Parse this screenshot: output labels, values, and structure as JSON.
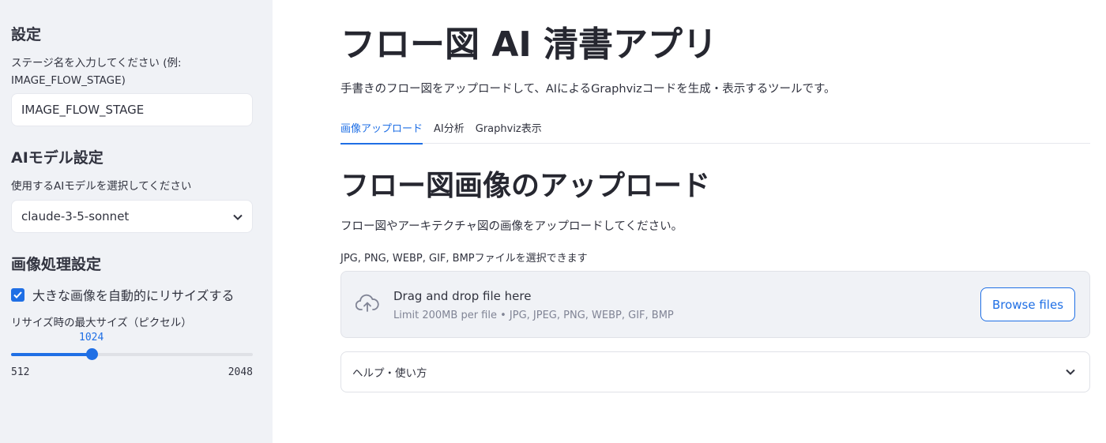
{
  "sidebar": {
    "settings_heading": "設定",
    "stage_label": "ステージ名を入力してください (例: IMAGE_FLOW_STAGE)",
    "stage_value": "IMAGE_FLOW_STAGE",
    "model_heading": "AIモデル設定",
    "model_label": "使用するAIモデルを選択してください",
    "model_selected": "claude-3-5-sonnet",
    "image_heading": "画像処理設定",
    "resize_checkbox_label": "大きな画像を自動的にリサイズする",
    "resize_checked": true,
    "max_size_label": "リサイズ時の最大サイズ（ピクセル）",
    "slider": {
      "value": "1024",
      "min": "512",
      "max": "2048"
    }
  },
  "main": {
    "title": "フロー図 AI 清書アプリ",
    "subtitle": "手書きのフロー図をアップロードして、AIによるGraphvizコードを生成・表示するツールです。",
    "tabs": [
      {
        "label": "画像アップロード",
        "active": true
      },
      {
        "label": "AI分析",
        "active": false
      },
      {
        "label": "Graphviz表示",
        "active": false
      }
    ],
    "section_title": "フロー図画像のアップロード",
    "section_desc": "フロー図やアーキテクチャ図の画像をアップロードしてください。",
    "uploader_label": "JPG, PNG, WEBP, GIF, BMPファイルを選択できます",
    "dropzone_title": "Drag and drop file here",
    "dropzone_sub": "Limit 200MB per file • JPG, JPEG, PNG, WEBP, GIF, BMP",
    "browse_label": "Browse files",
    "help_label": "ヘルプ・使い方"
  },
  "colors": {
    "accent": "#1f6fe5",
    "sidebar_bg": "#f0f2f6",
    "text": "#31333f"
  },
  "icons": {
    "upload": "cloud-upload-icon",
    "chevron": "chevron-down-icon",
    "check": "check-icon"
  }
}
